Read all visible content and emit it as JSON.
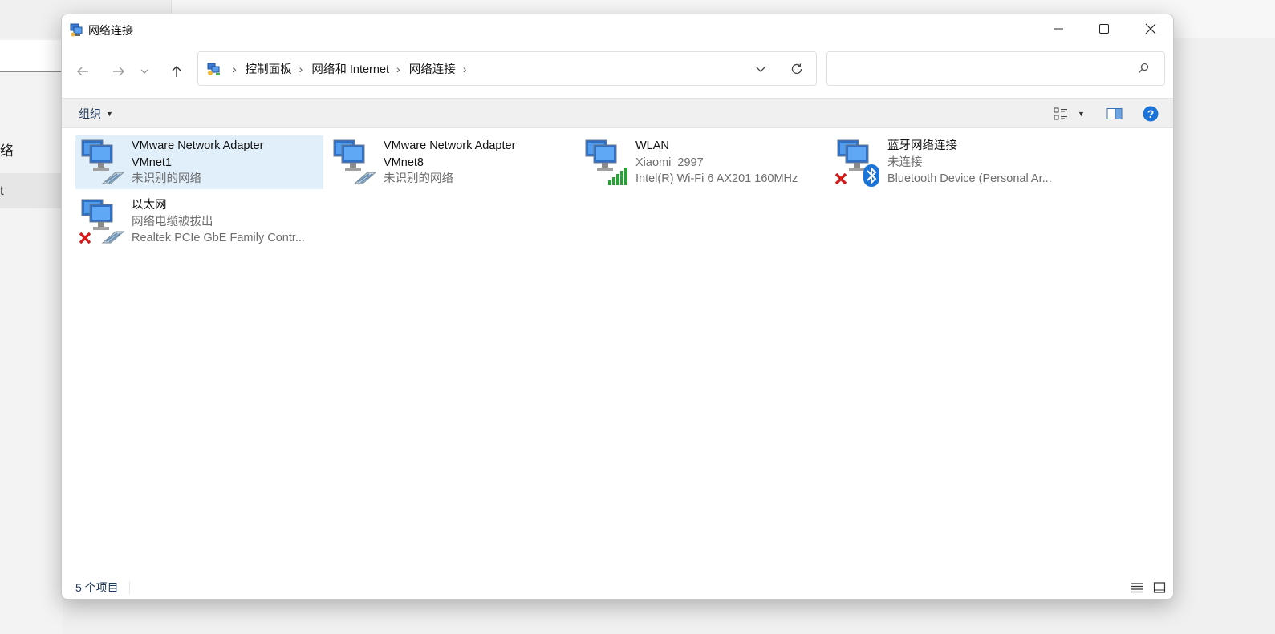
{
  "background": {
    "left_items": [
      {
        "label": "络"
      },
      {
        "label": "t"
      }
    ]
  },
  "window": {
    "title": "网络连接",
    "controls": {
      "minimize": "minimize-icon",
      "maximize": "maximize-icon",
      "close": "close-icon"
    }
  },
  "nav": {
    "breadcrumbs": [
      "控制面板",
      "网络和 Internet",
      "网络连接"
    ],
    "search_placeholder": ""
  },
  "toolbar": {
    "organize_label": "组织"
  },
  "adapters": [
    {
      "name_line1": "VMware Network Adapter",
      "name_line2": "VMnet1",
      "status": "未识别的网络",
      "device": "",
      "icon": "ethernet-adapter",
      "selected": true
    },
    {
      "name_line1": "VMware Network Adapter",
      "name_line2": "VMnet8",
      "status": "未识别的网络",
      "device": "",
      "icon": "ethernet-adapter",
      "selected": false
    },
    {
      "name_line1": "WLAN",
      "name_line2": "",
      "status": "Xiaomi_2997",
      "device": "Intel(R) Wi-Fi 6 AX201 160MHz",
      "icon": "wifi-adapter",
      "selected": false
    },
    {
      "name_line1": "蓝牙网络连接",
      "name_line2": "",
      "status": "未连接",
      "device": "Bluetooth Device (Personal Ar...",
      "icon": "bluetooth-adapter-disconnected",
      "selected": false
    },
    {
      "name_line1": "以太网",
      "name_line2": "",
      "status": "网络电缆被拔出",
      "device": "Realtek PCIe GbE Family Contr...",
      "icon": "ethernet-adapter-disconnected",
      "selected": false
    }
  ],
  "status": {
    "item_count": "5 个项目"
  },
  "colors": {
    "selection": "#e1effb",
    "link_text": "#1e395b",
    "help_blue": "#1a73d9"
  }
}
